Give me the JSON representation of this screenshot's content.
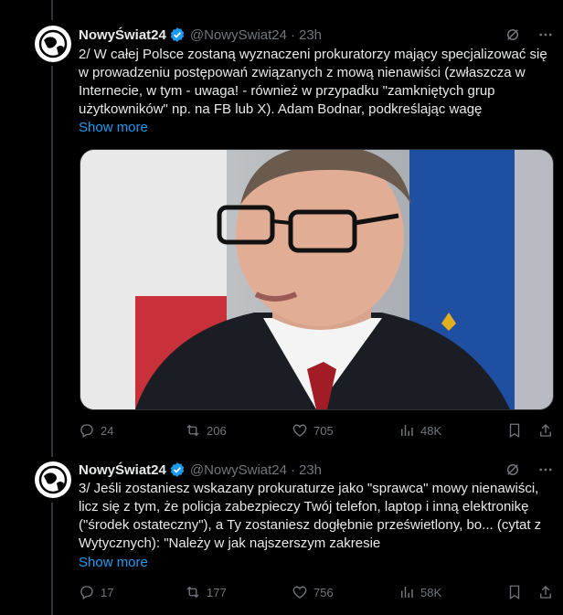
{
  "tweets": [
    {
      "author": "NowyŚwiat24",
      "handle": "@NowySwiat24",
      "time": "23h",
      "text": "2/ W całej Polsce zostaną wyznaczeni prokuratorzy mający specjalizować się w prowadzeniu postępowań związanych z mową nienawiści (zwłaszcza w Internecie, w tym - uwaga! - również w przypadku \"zamkniętych grup użytkowników\" np. na FB lub X). Adam Bodnar, podkreślając wagę",
      "show_more": "Show more",
      "replies": "24",
      "reposts": "206",
      "likes": "705",
      "views": "48K",
      "has_media": true
    },
    {
      "author": "NowyŚwiat24",
      "handle": "@NowySwiat24",
      "time": "23h",
      "text": "3/ Jeśli zostaniesz wskazany prokuraturze jako \"sprawca\" mowy nienawiści, licz się z tym, że policja zabezpieczy Twój telefon, laptop i inną elektronikę (\"środek ostateczny\"), a Ty zostaniesz dogłębnie prześwietlony, bo... (cytat z Wytycznych): \"Należy w jak najszerszym zakresie",
      "show_more": "Show more",
      "replies": "17",
      "reposts": "177",
      "likes": "756",
      "views": "58K",
      "has_media": false
    }
  ],
  "colors": {
    "accent": "#1d9bf0",
    "muted": "#71767b",
    "background": "#000000"
  }
}
